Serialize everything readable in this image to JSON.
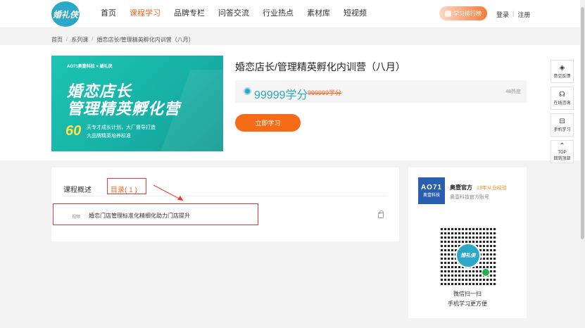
{
  "header": {
    "logo_text": "婚礼侠",
    "nav": [
      "首页",
      "课程学习",
      "品牌专栏",
      "问答交流",
      "行业热点",
      "素材库",
      "短视频"
    ],
    "active_nav": "课程学习",
    "rank_button": "学习排行榜",
    "login": "登录",
    "separator": "|",
    "register": "注册"
  },
  "breadcrumb": [
    "首页",
    "系列课",
    "婚恋店长/管理精英孵化内训营（八月）"
  ],
  "breadcrumb_sep": "/",
  "course": {
    "banner": {
      "brand": "AO71奥壹科技 × 婚礼侠",
      "title_line1": "婚恋店长",
      "title_line2": "管理精英孵化营",
      "number": "60",
      "sub1": "天专才成长计划，大厂督导打造",
      "sub2": "大品牌精英培养标准"
    },
    "title": "婚恋店长/管理精英孵化内训营（八月）",
    "price": "99999学分",
    "old_price": "999999学分",
    "heat": "48热度",
    "study_button": "立即学习"
  },
  "side_tools": [
    {
      "icon": "tag-icon",
      "glyph": "◈",
      "label": "意见反馈"
    },
    {
      "icon": "headset-icon",
      "glyph": "☊",
      "label": "在线咨询"
    },
    {
      "icon": "scan-icon",
      "glyph": "⊟",
      "label": "手机学习"
    },
    {
      "icon": "top-icon",
      "glyph": "⌃",
      "label": "TOP",
      "label2": "回到顶部"
    }
  ],
  "tabs": {
    "overview": "课程概述",
    "catalog": "目录( 1 )"
  },
  "lessons": [
    {
      "type": "视频",
      "name": "婚恋门店管理标准化精细化助力门店提升"
    }
  ],
  "org": {
    "logo_line1": "AO71",
    "logo_line2": "奥壹科技",
    "name": "奥壹官方",
    "experience": "13年从业经验",
    "desc": "奥壹科技官方账号",
    "qr_text": "婚礼侠",
    "scan_line1": "微信扫一扫",
    "scan_line2": "手机学习更方便"
  },
  "colors": {
    "accent": "#f5651f",
    "brand": "#2ba8c7",
    "annotation": "#e03a3a"
  }
}
